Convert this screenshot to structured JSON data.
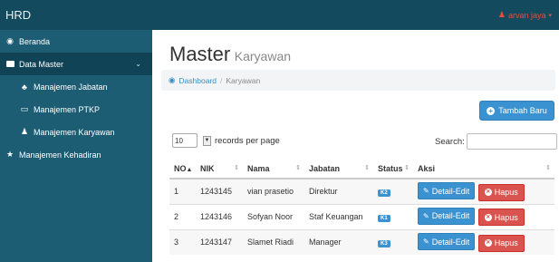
{
  "app": {
    "brand": "HRD",
    "user_name": "arvan jaya",
    "user_caret": "▾"
  },
  "sidebar": {
    "items": [
      {
        "label": "Beranda",
        "icon": "dashboard-icon"
      },
      {
        "label": "Data Master",
        "icon": "folder-icon",
        "active": true
      },
      {
        "label": "Manajemen Jabatan",
        "icon": "sitemap-icon"
      },
      {
        "label": "Manajemen PTKP",
        "icon": "card-icon"
      },
      {
        "label": "Manajemen Karyawan",
        "icon": "users-icon"
      },
      {
        "label": "Manajemen Kehadiran",
        "icon": "star-icon"
      }
    ]
  },
  "page": {
    "title": "Master",
    "subtitle": "Karyawan"
  },
  "breadcrumb": {
    "home": "Dashboard",
    "separator": "/",
    "current": "Karyawan"
  },
  "actions": {
    "add_label": "Tambah Baru"
  },
  "table_controls": {
    "page_size": "10",
    "records_label": "records per page",
    "search_label": "Search:"
  },
  "table": {
    "headers": [
      "NO",
      "NIK",
      "Nama",
      "Jabatan",
      "Status",
      "Aksi"
    ],
    "rows": [
      {
        "no": "1",
        "nik": "1243145",
        "nama": "vian prasetio",
        "jabatan": "Direktur",
        "status": "K2"
      },
      {
        "no": "2",
        "nik": "1243146",
        "nama": "Sofyan Noor",
        "jabatan": "Staf Keuangan",
        "status": "K1"
      },
      {
        "no": "3",
        "nik": "1243147",
        "nama": "Slamet Riadi",
        "jabatan": "Manager",
        "status": "K3"
      }
    ],
    "edit_label": "Detail-Edit",
    "delete_label": "Hapus"
  },
  "colors": {
    "topbar": "#134a5e",
    "sidebar": "#1c5d73",
    "primary": "#3a92d0",
    "danger": "#d9534f"
  }
}
